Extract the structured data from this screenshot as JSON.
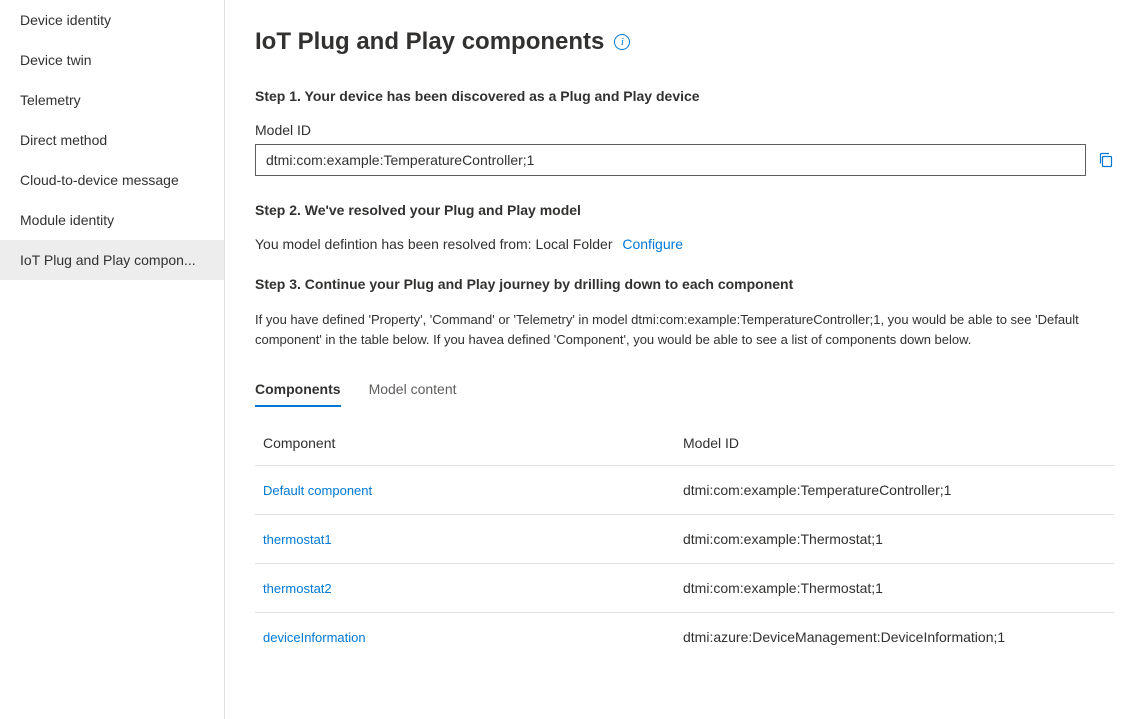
{
  "sidebar": {
    "items": [
      {
        "label": "Device identity"
      },
      {
        "label": "Device twin"
      },
      {
        "label": "Telemetry"
      },
      {
        "label": "Direct method"
      },
      {
        "label": "Cloud-to-device message"
      },
      {
        "label": "Module identity"
      },
      {
        "label": "IoT Plug and Play compon...",
        "selected": true
      }
    ]
  },
  "header": {
    "title": "IoT Plug and Play components"
  },
  "step1": {
    "heading": "Step 1. Your device has been discovered as a Plug and Play device",
    "model_id_label": "Model ID",
    "model_id_value": "dtmi:com:example:TemperatureController;1"
  },
  "step2": {
    "heading": "Step 2. We've resolved your Plug and Play model",
    "body": "You model defintion has been resolved from: Local Folder",
    "configure_label": "Configure"
  },
  "step3": {
    "heading": "Step 3. Continue your Plug and Play journey by drilling down to each component",
    "description": "If you have defined 'Property', 'Command' or 'Telemetry' in model dtmi:com:example:TemperatureController;1, you would be able to see 'Default component' in the table below. If you havea defined 'Component', you would be able to see a list of components down below."
  },
  "tabs": {
    "components": "Components",
    "model_content": "Model content"
  },
  "table": {
    "header_component": "Component",
    "header_model_id": "Model ID",
    "rows": [
      {
        "component": "Default component",
        "model_id": "dtmi:com:example:TemperatureController;1"
      },
      {
        "component": "thermostat1",
        "model_id": "dtmi:com:example:Thermostat;1"
      },
      {
        "component": "thermostat2",
        "model_id": "dtmi:com:example:Thermostat;1"
      },
      {
        "component": "deviceInformation",
        "model_id": "dtmi:azure:DeviceManagement:DeviceInformation;1"
      }
    ]
  }
}
